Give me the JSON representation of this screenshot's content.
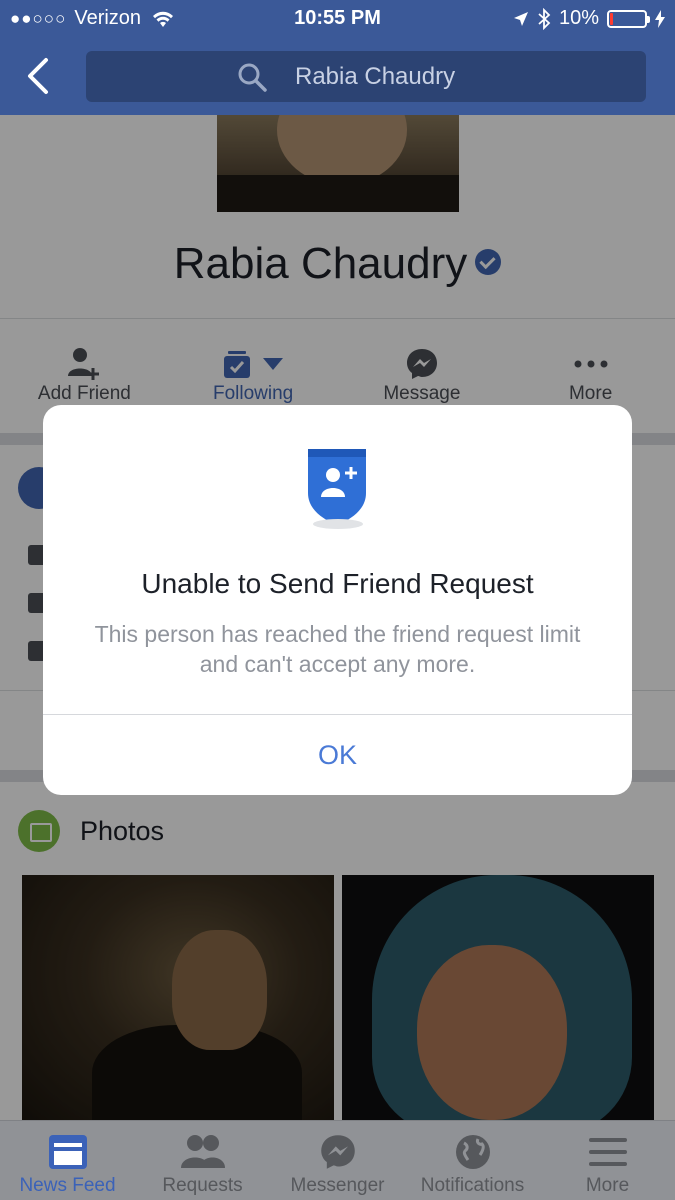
{
  "status_bar": {
    "signal": "●●○○○",
    "carrier": "Verizon",
    "time": "10:55 PM",
    "battery_text": "10%",
    "battery_level": 0.1
  },
  "nav": {
    "search_value": "Rabia Chaudry"
  },
  "profile": {
    "name": "Rabia Chaudry",
    "actions": [
      {
        "label": "Add Friend",
        "icon": "add-friend-icon"
      },
      {
        "label": "Following",
        "icon": "following-icon"
      },
      {
        "label": "Message",
        "icon": "messenger-icon"
      },
      {
        "label": "More",
        "icon": "more-icon"
      }
    ]
  },
  "photos": {
    "title": "Photos"
  },
  "dialog": {
    "title": "Unable to Send Friend Request",
    "message": "This person has reached the friend request limit and can't accept any more.",
    "ok_label": "OK"
  },
  "tabs": [
    {
      "label": "News Feed",
      "icon": "news-feed-icon",
      "active": true
    },
    {
      "label": "Requests",
      "icon": "requests-icon",
      "active": false
    },
    {
      "label": "Messenger",
      "icon": "messenger-icon",
      "active": false
    },
    {
      "label": "Notifications",
      "icon": "globe-icon",
      "active": false
    },
    {
      "label": "More",
      "icon": "hamburger-icon",
      "active": false
    }
  ],
  "colors": {
    "nav_blue": "#3b5998",
    "link_blue": "#4a7ad6",
    "battery_red": "#ff3b30"
  }
}
